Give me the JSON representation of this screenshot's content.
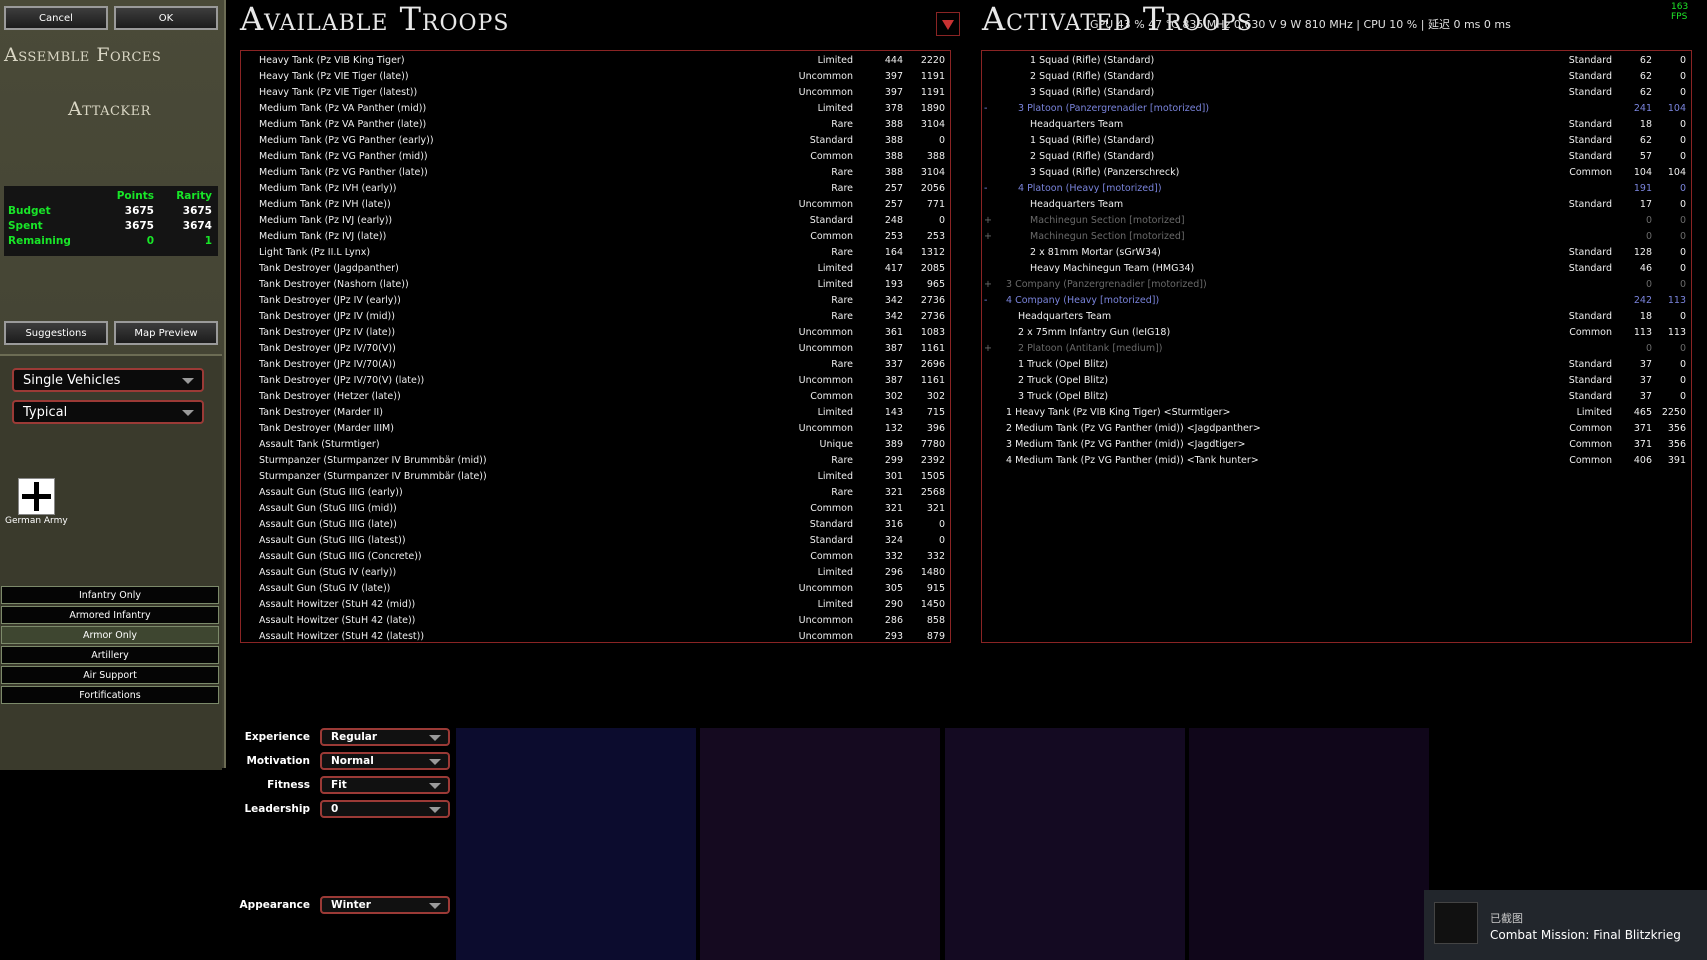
{
  "left_panel": {
    "cancel": "Cancel",
    "ok": "OK",
    "section_title": "Assemble Forces",
    "role": "Attacker",
    "budget": {
      "headers": [
        "Points",
        "Rarity"
      ],
      "rows": [
        {
          "label": "Budget",
          "points": "3675",
          "rarity": "3675"
        },
        {
          "label": "Spent",
          "points": "3675",
          "rarity": "3674"
        },
        {
          "label": "Remaining",
          "points": "0",
          "rarity": "1"
        }
      ]
    },
    "suggestions": "Suggestions",
    "map_preview": "Map Preview",
    "unit_type": "Single Vehicles",
    "size_filter": "Typical",
    "nation": "German Army",
    "filters": [
      "Infantry Only",
      "Armored Infantry",
      "Armor Only",
      "Artillery",
      "Air Support",
      "Fortifications"
    ],
    "selected_filter": "Armor Only"
  },
  "available": {
    "title": "Available Troops",
    "rows": [
      [
        "Heavy Tank (Pz VIB King Tiger)",
        "Limited",
        "444",
        "2220"
      ],
      [
        "Heavy Tank (Pz VIE Tiger (late))",
        "Uncommon",
        "397",
        "1191"
      ],
      [
        "Heavy Tank (Pz VIE Tiger (latest))",
        "Uncommon",
        "397",
        "1191"
      ],
      [
        "Medium Tank (Pz VA Panther (mid))",
        "Limited",
        "378",
        "1890"
      ],
      [
        "Medium Tank (Pz VA Panther (late))",
        "Rare",
        "388",
        "3104"
      ],
      [
        "Medium Tank (Pz VG Panther (early))",
        "Standard",
        "388",
        "0"
      ],
      [
        "Medium Tank (Pz VG Panther (mid))",
        "Common",
        "388",
        "388"
      ],
      [
        "Medium Tank (Pz VG Panther (late))",
        "Rare",
        "388",
        "3104"
      ],
      [
        "Medium Tank (Pz IVH (early))",
        "Rare",
        "257",
        "2056"
      ],
      [
        "Medium Tank (Pz IVH (late))",
        "Uncommon",
        "257",
        "771"
      ],
      [
        "Medium Tank (Pz IVJ (early))",
        "Standard",
        "248",
        "0"
      ],
      [
        "Medium Tank (Pz IVJ (late))",
        "Common",
        "253",
        "253"
      ],
      [
        "Light Tank (Pz II.L Lynx)",
        "Rare",
        "164",
        "1312"
      ],
      [
        "Tank Destroyer (Jagdpanther)",
        "Limited",
        "417",
        "2085"
      ],
      [
        "Tank Destroyer (Nashorn (late))",
        "Limited",
        "193",
        "965"
      ],
      [
        "Tank Destroyer (JPz IV (early))",
        "Rare",
        "342",
        "2736"
      ],
      [
        "Tank Destroyer (JPz IV (mid))",
        "Rare",
        "342",
        "2736"
      ],
      [
        "Tank Destroyer (JPz IV (late))",
        "Uncommon",
        "361",
        "1083"
      ],
      [
        "Tank Destroyer (JPz IV/70(V))",
        "Uncommon",
        "387",
        "1161"
      ],
      [
        "Tank Destroyer (JPz IV/70(A))",
        "Rare",
        "337",
        "2696"
      ],
      [
        "Tank Destroyer (JPz IV/70(V) (late))",
        "Uncommon",
        "387",
        "1161"
      ],
      [
        "Tank Destroyer (Hetzer (late))",
        "Common",
        "302",
        "302"
      ],
      [
        "Tank Destroyer (Marder II)",
        "Limited",
        "143",
        "715"
      ],
      [
        "Tank Destroyer (Marder IIIM)",
        "Uncommon",
        "132",
        "396"
      ],
      [
        "Assault Tank (Sturmtiger)",
        "Unique",
        "389",
        "7780"
      ],
      [
        "Sturmpanzer (Sturmpanzer IV Brummbär (mid))",
        "Rare",
        "299",
        "2392"
      ],
      [
        "Sturmpanzer (Sturmpanzer IV Brummbär (late))",
        "Limited",
        "301",
        "1505"
      ],
      [
        "Assault Gun (StuG IIIG (early))",
        "Rare",
        "321",
        "2568"
      ],
      [
        "Assault Gun (StuG IIIG (mid))",
        "Common",
        "321",
        "321"
      ],
      [
        "Assault Gun (StuG IIIG (late))",
        "Standard",
        "316",
        "0"
      ],
      [
        "Assault Gun (StuG IIIG (latest))",
        "Standard",
        "324",
        "0"
      ],
      [
        "Assault Gun (StuG IIIG (Concrete))",
        "Common",
        "332",
        "332"
      ],
      [
        "Assault Gun (StuG IV (early))",
        "Limited",
        "296",
        "1480"
      ],
      [
        "Assault Gun (StuG IV (late))",
        "Uncommon",
        "305",
        "915"
      ],
      [
        "Assault Howitzer (StuH 42 (mid))",
        "Limited",
        "290",
        "1450"
      ],
      [
        "Assault Howitzer (StuH 42 (late))",
        "Uncommon",
        "286",
        "858"
      ],
      [
        "Assault Howitzer (StuH 42 (latest))",
        "Uncommon",
        "293",
        "879"
      ]
    ]
  },
  "activated": {
    "title": "Activated Troops",
    "rows": [
      {
        "pm": "",
        "indent": 3,
        "style": "",
        "name": "1 Squad (Rifle) (Standard)",
        "rarity": "Standard",
        "points": "62",
        "rty": "0"
      },
      {
        "pm": "",
        "indent": 3,
        "style": "",
        "name": "2 Squad (Rifle) (Standard)",
        "rarity": "Standard",
        "points": "62",
        "rty": "0"
      },
      {
        "pm": "",
        "indent": 3,
        "style": "",
        "name": "3 Squad (Rifle) (Standard)",
        "rarity": "Standard",
        "points": "62",
        "rty": "0"
      },
      {
        "pm": "-",
        "indent": 2,
        "style": "blue",
        "name": "3 Platoon (Panzergrenadier [motorized])",
        "rarity": "",
        "points": "241",
        "rty": "104"
      },
      {
        "pm": "",
        "indent": 3,
        "style": "",
        "name": "Headquarters Team",
        "rarity": "Standard",
        "points": "18",
        "rty": "0"
      },
      {
        "pm": "",
        "indent": 3,
        "style": "",
        "name": "1 Squad (Rifle) (Standard)",
        "rarity": "Standard",
        "points": "62",
        "rty": "0"
      },
      {
        "pm": "",
        "indent": 3,
        "style": "",
        "name": "2 Squad (Rifle) (Standard)",
        "rarity": "Standard",
        "points": "57",
        "rty": "0"
      },
      {
        "pm": "",
        "indent": 3,
        "style": "",
        "name": "3 Squad (Rifle) (Panzerschreck)",
        "rarity": "Common",
        "points": "104",
        "rty": "104"
      },
      {
        "pm": "-",
        "indent": 2,
        "style": "blue",
        "name": "4 Platoon (Heavy [motorized])",
        "rarity": "",
        "points": "191",
        "rty": "0"
      },
      {
        "pm": "",
        "indent": 3,
        "style": "",
        "name": "Headquarters Team",
        "rarity": "Standard",
        "points": "17",
        "rty": "0"
      },
      {
        "pm": "+",
        "indent": 3,
        "style": "dim",
        "name": "Machinegun Section [motorized]",
        "rarity": "",
        "points": "0",
        "rty": "0"
      },
      {
        "pm": "+",
        "indent": 3,
        "style": "dim",
        "name": "Machinegun Section [motorized]",
        "rarity": "",
        "points": "0",
        "rty": "0"
      },
      {
        "pm": "",
        "indent": 3,
        "style": "",
        "name": "2 x 81mm Mortar (sGrW34)",
        "rarity": "Standard",
        "points": "128",
        "rty": "0"
      },
      {
        "pm": "",
        "indent": 3,
        "style": "",
        "name": "Heavy Machinegun Team (HMG34)",
        "rarity": "Standard",
        "points": "46",
        "rty": "0"
      },
      {
        "pm": "+",
        "indent": 1,
        "style": "dim",
        "name": "3 Company (Panzergrenadier [motorized])",
        "rarity": "",
        "points": "0",
        "rty": "0"
      },
      {
        "pm": "-",
        "indent": 1,
        "style": "blue",
        "name": "4 Company (Heavy [motorized])",
        "rarity": "",
        "points": "242",
        "rty": "113"
      },
      {
        "pm": "",
        "indent": 2,
        "style": "",
        "name": "Headquarters Team",
        "rarity": "Standard",
        "points": "18",
        "rty": "0"
      },
      {
        "pm": "",
        "indent": 2,
        "style": "",
        "name": "2 x 75mm Infantry Gun (leIG18)",
        "rarity": "Common",
        "points": "113",
        "rty": "113"
      },
      {
        "pm": "+",
        "indent": 2,
        "style": "dim",
        "name": "2 Platoon (Antitank [medium])",
        "rarity": "",
        "points": "0",
        "rty": "0"
      },
      {
        "pm": "",
        "indent": 2,
        "style": "",
        "name": "1 Truck (Opel Blitz)",
        "rarity": "Standard",
        "points": "37",
        "rty": "0"
      },
      {
        "pm": "",
        "indent": 2,
        "style": "",
        "name": "2 Truck (Opel Blitz)",
        "rarity": "Standard",
        "points": "37",
        "rty": "0"
      },
      {
        "pm": "",
        "indent": 2,
        "style": "",
        "name": "3 Truck (Opel Blitz)",
        "rarity": "Standard",
        "points": "37",
        "rty": "0"
      },
      {
        "pm": "",
        "indent": 1,
        "style": "",
        "name": "1 Heavy Tank (Pz VIB King Tiger) <Sturmtiger>",
        "rarity": "Limited",
        "points": "465",
        "rty": "2250"
      },
      {
        "pm": "",
        "indent": 1,
        "style": "",
        "name": "2 Medium Tank (Pz VG Panther (mid)) <Jagdpanther>",
        "rarity": "Common",
        "points": "371",
        "rty": "356"
      },
      {
        "pm": "",
        "indent": 1,
        "style": "",
        "name": "3 Medium Tank (Pz VG Panther (mid)) <Jagdtiger>",
        "rarity": "Common",
        "points": "371",
        "rty": "356"
      },
      {
        "pm": "",
        "indent": 1,
        "style": "",
        "name": "4 Medium Tank (Pz VG Panther (mid)) <Tank hunter>",
        "rarity": "Common",
        "points": "406",
        "rty": "391"
      }
    ]
  },
  "settings": {
    "experience": {
      "label": "Experience",
      "value": "Regular"
    },
    "motivation": {
      "label": "Motivation",
      "value": "Normal"
    },
    "fitness": {
      "label": "Fitness",
      "value": "Fit"
    },
    "leadership": {
      "label": "Leadership",
      "value": "0"
    },
    "appearance": {
      "label": "Appearance",
      "value": "Winter"
    }
  },
  "overlay": {
    "fps": "163 FPS",
    "hud": "GPU 43 % 47 °C 835 MHz 0.630 V 9 W 810 MHz | CPU 10 % | 延迟 0 ms 0 ms",
    "toast_line1": "已截图",
    "toast_line2": "Combat Mission: Final Blitzkrieg"
  },
  "colors": {
    "accent_red": "#8a2424",
    "budget_green": "#18e628",
    "group_blue": "#7a84dc"
  }
}
